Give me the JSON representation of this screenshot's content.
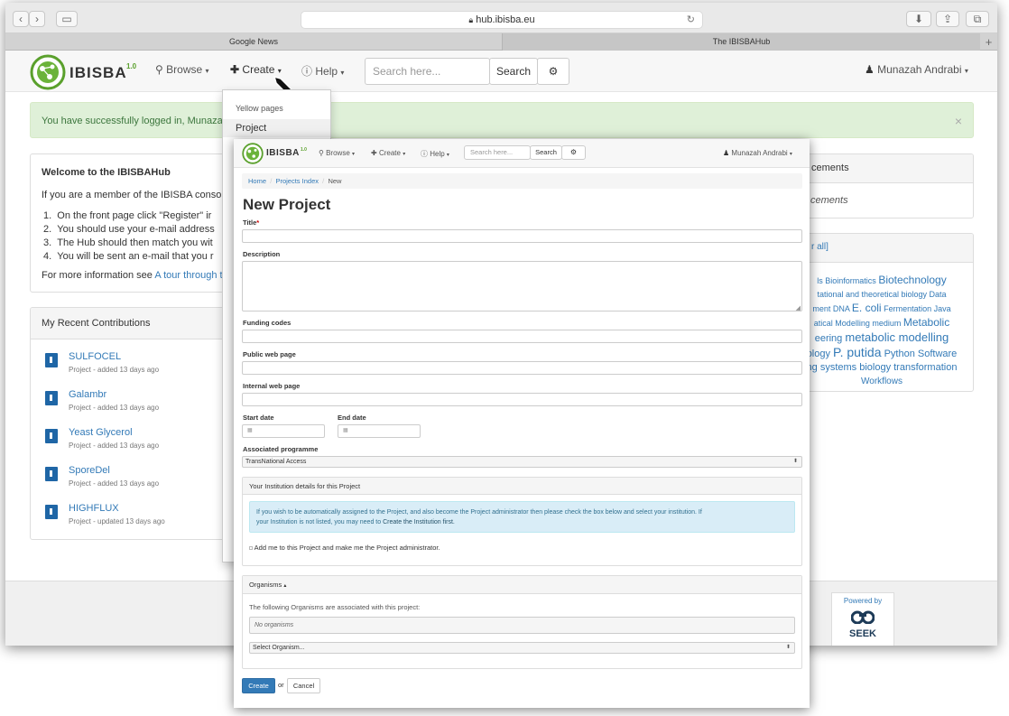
{
  "browser": {
    "url": "hub.ibisba.eu",
    "tabs": [
      "Google News",
      "The IBISBAHub"
    ],
    "new_tab": "+"
  },
  "app": {
    "logo_text": "IBISBA",
    "logo_version": "1.0",
    "nav": {
      "browse": "Browse",
      "create": "Create",
      "help": "Help",
      "search_placeholder": "Search here...",
      "search_button": "Search",
      "user": "Munazah Andrabi"
    }
  },
  "create_menu": {
    "items": [
      "Yellow pages",
      "Project"
    ]
  },
  "alert": {
    "text": "You have successfully logged in, Munazah",
    "close": "×"
  },
  "welcome": {
    "title": "Welcome to the IBISBAHub",
    "intro": "If you are a member of the IBISBA consort",
    "steps": [
      "On the front page click \"Register\" ir",
      "You should use your e-mail address",
      "The Hub should then match you wit",
      "You will be sent an e-mail that you r"
    ],
    "more_prefix": "For more information see ",
    "more_link": "A tour through th"
  },
  "contributions": {
    "title": "My Recent Contributions",
    "items": [
      {
        "title": "SULFOCEL",
        "sub": "Project - added 13 days ago"
      },
      {
        "title": "Galambr",
        "sub": "Project - added 13 days ago"
      },
      {
        "title": "Yeast Glycerol",
        "sub": "Project - added 13 days ago"
      },
      {
        "title": "SporeDel",
        "sub": "Project - added 13 days ago"
      },
      {
        "title": "HIGHFLUX",
        "sub": "Project - updated 13 days ago"
      }
    ]
  },
  "announcements": {
    "title": "cements",
    "body": "cements"
  },
  "tags": {
    "head": "r all]",
    "lines": [
      [
        "ls Bioinformatics ",
        "Biotechnology"
      ],
      [
        "tational and theoretical biology Data"
      ],
      [
        "ment DNA ",
        "E. coli",
        " Fermentation Java"
      ],
      [
        "atical Modelling medium ",
        "Metabolic"
      ],
      [
        "eering ",
        "metabolic modelling"
      ],
      [
        "ology ",
        "P. putida",
        " Python Software"
      ],
      [
        "ng systems biology transformation"
      ],
      [
        "Workflows"
      ]
    ]
  },
  "footer": {
    "powered_by": "Powered by",
    "seek": "SEEK"
  },
  "form": {
    "breadcrumb": [
      "Home",
      "Projects Index",
      "New"
    ],
    "heading": "New Project",
    "labels": {
      "title": "Title",
      "required": "*",
      "description": "Description",
      "funding": "Funding codes",
      "public_web": "Public web page",
      "internal_web": "Internal web page",
      "start_date": "Start date",
      "end_date": "End date",
      "programme": "Associated programme"
    },
    "programme_value": "TransNational Access",
    "institution": {
      "title": "Your Institution details for this Project",
      "info_1": "If you wish to be automatically assigned to the Project, and also become the Project administrator then please check the box below and select your institution. If",
      "info_2_prefix": "your Institution is not listed, you may need to ",
      "info_2_link": "Create the Institution first.",
      "checkbox_label": "Add me to this Project and make me the Project administrator."
    },
    "organisms": {
      "title": "Organisms",
      "intro": "The following Organisms are associated with this project:",
      "none": "No organisms",
      "select": "Select Organism..."
    },
    "create_button": "Create",
    "or": "or",
    "cancel_button": "Cancel"
  },
  "colors": {
    "link": "#337ab7",
    "primary": "#337ab7",
    "alert_bg": "#dff0d8",
    "logo_green": "#5aa02c"
  }
}
